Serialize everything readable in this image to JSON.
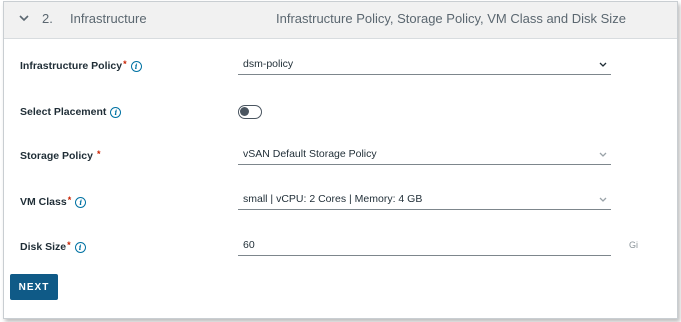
{
  "step": {
    "number": "2.",
    "title": "Infrastructure",
    "description": "Infrastructure Policy, Storage Policy, VM Class and Disk Size"
  },
  "fields": {
    "infrastructure_policy": {
      "label": "Infrastructure Policy",
      "required_mark": "*",
      "value": "dsm-policy"
    },
    "select_placement": {
      "label": "Select Placement",
      "toggle_on": false
    },
    "storage_policy": {
      "label": "Storage Policy",
      "required_mark": "*",
      "value": "vSAN Default Storage Policy"
    },
    "vm_class": {
      "label": "VM Class",
      "required_mark": "*",
      "value": "small | vCPU: 2 Cores | Memory: 4 GB"
    },
    "disk_size": {
      "label": "Disk Size",
      "required_mark": "*",
      "value": "60",
      "unit": "Gi"
    }
  },
  "info_glyph": "i",
  "next_label": "NEXT",
  "colors": {
    "primary": "#0f5a87",
    "required": "#c92100",
    "info": "#0072a3"
  }
}
